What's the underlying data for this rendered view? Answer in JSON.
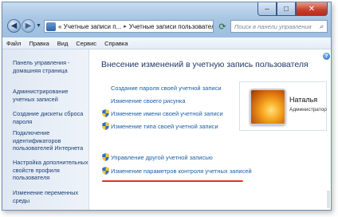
{
  "window": {
    "controls": {
      "minimize": "–",
      "maximize": "□",
      "close": "✕"
    }
  },
  "address": {
    "crumbs": [
      "« Учетные записи п...",
      "Учетные записи пользователей"
    ],
    "separator": "▸"
  },
  "search": {
    "placeholder": "Поиск в панели управления"
  },
  "menu": [
    "Файл",
    "Правка",
    "Вид",
    "Сервис",
    "Справка"
  ],
  "left_panel": {
    "items": [
      "Панель управления - домашняя страница",
      "Администрирование учетных записей",
      "Создание дискеты сброса пароля",
      "Подключение идентификаторов пользователей Интернета",
      "Настройка дополнительных свойств профиля пользователя",
      "Изменение переменных среды"
    ]
  },
  "main": {
    "title": "Внесение изменений в учетную запись пользователя",
    "tasks": [
      {
        "label": "Создание пароля своей учетной записи",
        "shield": false
      },
      {
        "label": "Изменение своего рисунка",
        "shield": false
      },
      {
        "label": "Изменение имени своей учетной записи",
        "shield": true
      },
      {
        "label": "Изменение типа своей учетной записи",
        "shield": true
      }
    ],
    "other_tasks": [
      {
        "label": "Управление другой учетной записью",
        "shield": true
      },
      {
        "label": "Изменение параметров контроля учетных записей",
        "shield": true
      }
    ]
  },
  "user": {
    "name": "Наталья",
    "role": "Администратор"
  },
  "colors": {
    "link": "#1a5fa6",
    "annotation_underline": "#e0331f"
  }
}
